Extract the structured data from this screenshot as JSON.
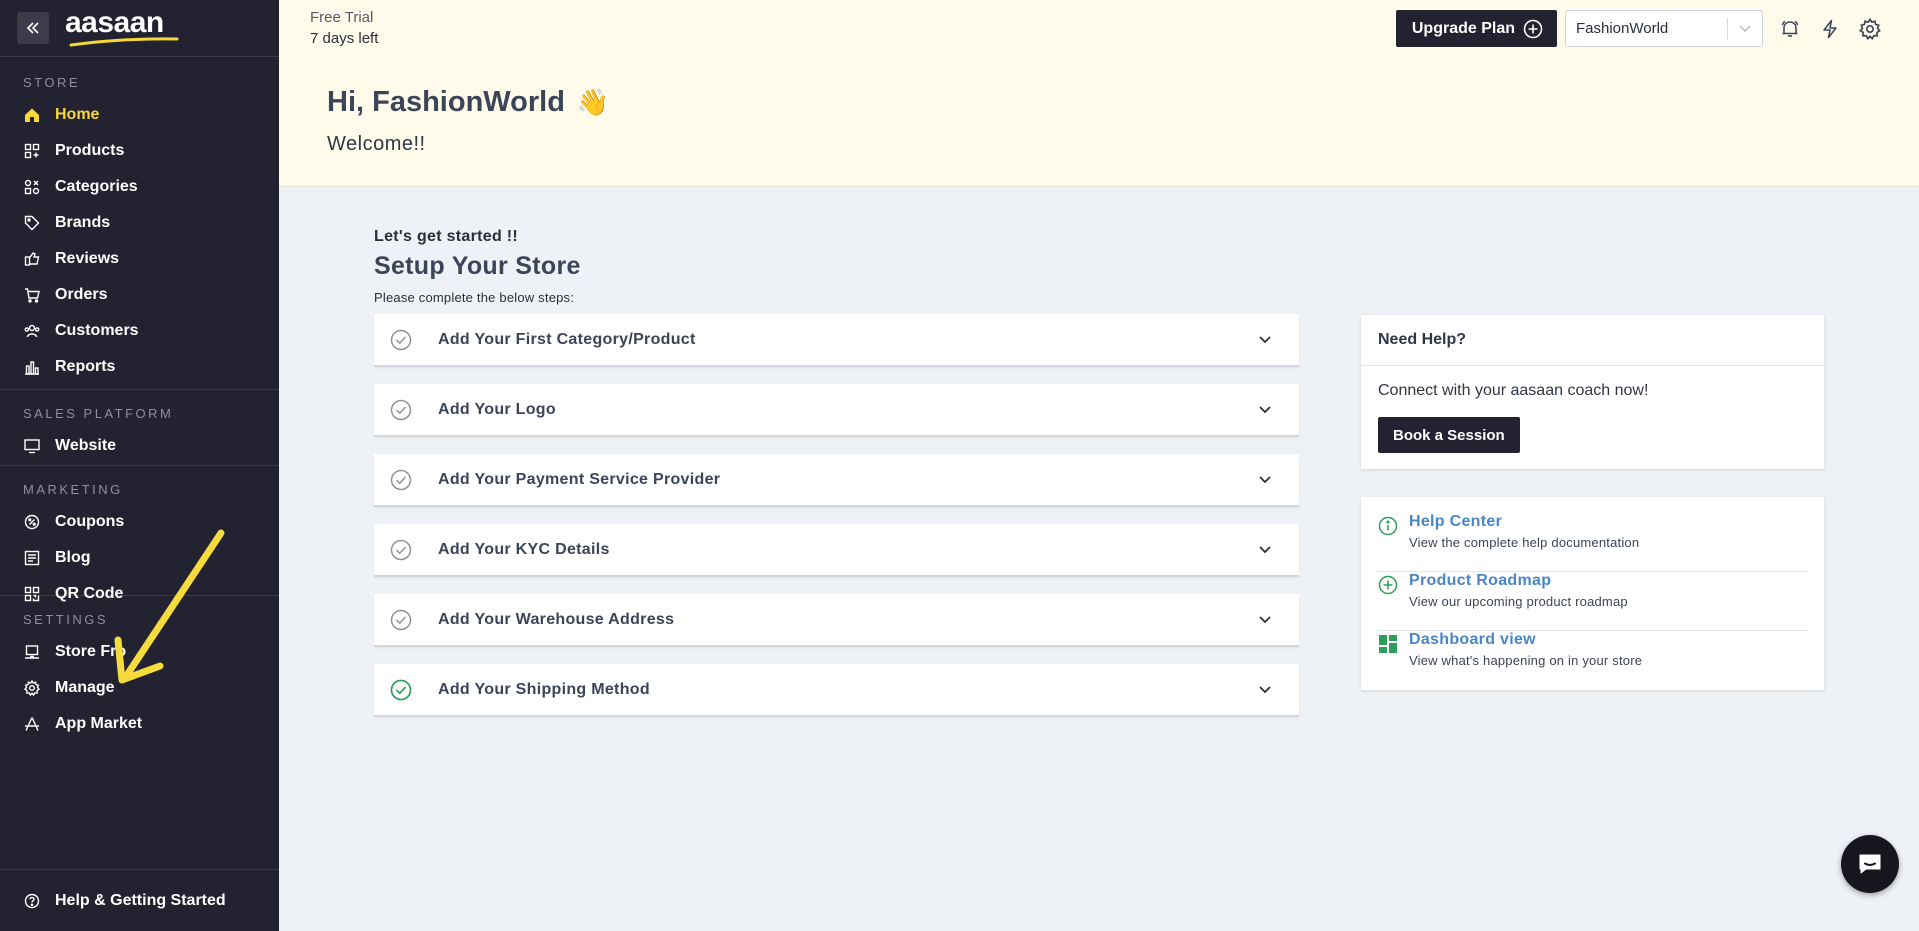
{
  "sidebar": {
    "logo": "aasaan",
    "sections": [
      {
        "heading": "STORE",
        "items": [
          {
            "label": "Home",
            "icon": "home-icon"
          },
          {
            "label": "Products",
            "icon": "products-icon"
          },
          {
            "label": "Categories",
            "icon": "categories-icon"
          },
          {
            "label": "Brands",
            "icon": "tag-icon"
          },
          {
            "label": "Reviews",
            "icon": "reviews-icon"
          },
          {
            "label": "Orders",
            "icon": "cart-icon"
          },
          {
            "label": "Customers",
            "icon": "users-icon"
          },
          {
            "label": "Reports",
            "icon": "bar-chart-icon"
          }
        ]
      },
      {
        "heading": "SALES PLATFORM",
        "items": [
          {
            "label": "Website",
            "icon": "monitor-icon"
          }
        ]
      },
      {
        "heading": "MARKETING",
        "items": [
          {
            "label": "Coupons",
            "icon": "coupon-icon"
          },
          {
            "label": "Blog",
            "icon": "blog-icon"
          },
          {
            "label": "QR Code",
            "icon": "qr-code-icon"
          }
        ]
      },
      {
        "heading": "SETTINGS",
        "items": [
          {
            "label": "Store Fro",
            "icon": "storefront-icon"
          },
          {
            "label": "Manage",
            "icon": "gear-icon"
          },
          {
            "label": "App Market",
            "icon": "app-market-icon"
          }
        ]
      }
    ],
    "footer": "Help & Getting Started",
    "active_color": "#f7d83a",
    "bg_color": "#222230"
  },
  "header": {
    "trial_line1": "Free Trial",
    "trial_line2": "7 days left",
    "upgrade_label": "Upgrade Plan",
    "store_selected": "FashionWorld",
    "greeting": "Hi, FashionWorld",
    "greeting_emoji": "👋",
    "welcome": "Welcome!!"
  },
  "setup": {
    "kicker": "Let's get started !!",
    "title": "Setup Your Store",
    "subtitle": "Please complete the below steps:",
    "steps": [
      {
        "label": "Add Your First Category/Product",
        "done": false
      },
      {
        "label": "Add Your Logo",
        "done": false
      },
      {
        "label": "Add Your Payment Service Provider",
        "done": false
      },
      {
        "label": "Add Your KYC Details",
        "done": false
      },
      {
        "label": "Add Your Warehouse Address",
        "done": false
      },
      {
        "label": "Add Your Shipping Method",
        "done": true
      }
    ]
  },
  "help": {
    "title": "Need Help?",
    "text": "Connect with your aasaan coach now!",
    "button": "Book a Session"
  },
  "links": [
    {
      "title": "Help Center",
      "desc": "View the complete help documentation",
      "icon": "info-icon"
    },
    {
      "title": "Product Roadmap",
      "desc": "View our upcoming product roadmap",
      "icon": "plus-circle-icon"
    },
    {
      "title": "Dashboard view",
      "desc": "View what's happening on in your store",
      "icon": "dashboard-icon"
    }
  ],
  "colors": {
    "accent_dark": "#222230",
    "link_blue": "#4a86c5",
    "success_green": "#2e9e5b",
    "hero_bg": "#fffbeb",
    "annotation_yellow": "#f5dc3c"
  }
}
